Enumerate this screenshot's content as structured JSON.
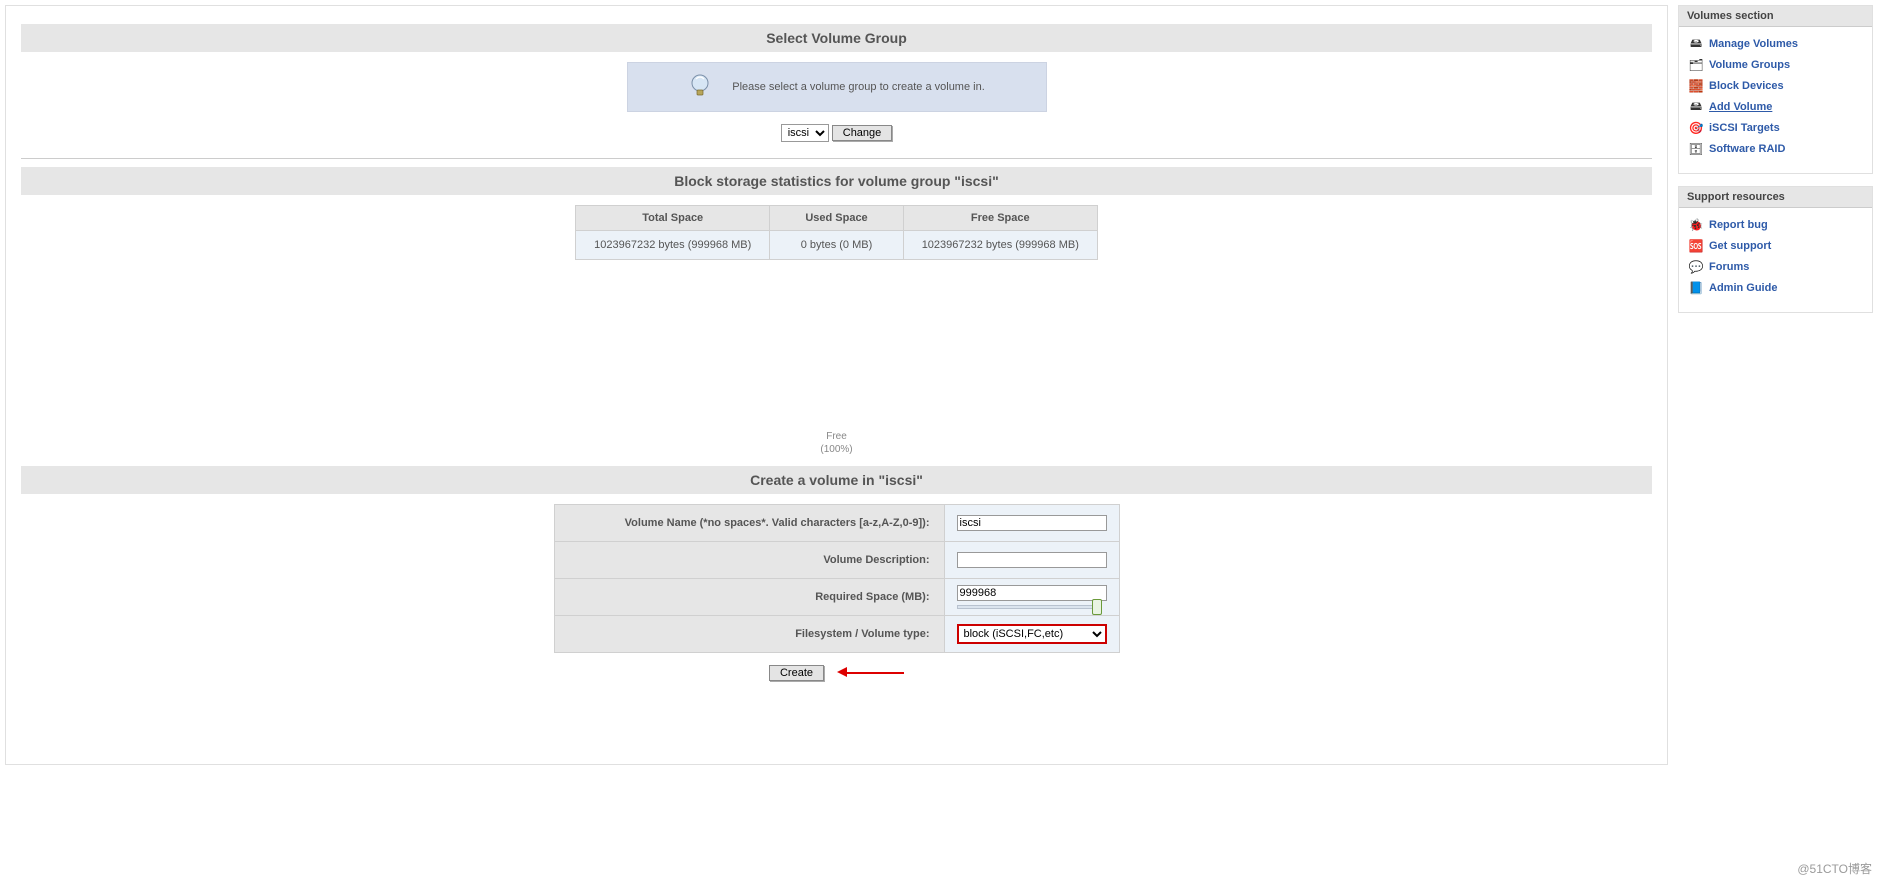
{
  "sections": {
    "select_vg_title": "Select Volume Group",
    "info_message": "Please select a volume group to create a volume in.",
    "vg_select_value": "iscsi",
    "change_btn": "Change",
    "stats_title": "Block storage statistics for volume group \"iscsi\"",
    "stats_headers": {
      "total": "Total Space",
      "used": "Used Space",
      "free": "Free Space"
    },
    "stats_values": {
      "total": "1023967232 bytes (999968 MB)",
      "used": "0 bytes (0 MB)",
      "free": "1023967232 bytes (999968 MB)"
    },
    "pie_label_1": "Free",
    "pie_label_2": "(100%)",
    "create_title": "Create a volume in \"iscsi\"",
    "form": {
      "name_label": "Volume Name (*no spaces*. Valid characters [a-z,A-Z,0-9]):",
      "name_value": "iscsi",
      "desc_label": "Volume Description:",
      "desc_value": "",
      "space_label": "Required Space (MB):",
      "space_value": "999968",
      "fs_label": "Filesystem / Volume type:",
      "fs_value": "block (iSCSI,FC,etc)"
    },
    "create_btn": "Create"
  },
  "sidebar": {
    "volumes_title": "Volumes section",
    "items": [
      {
        "icon": "drive-icon",
        "label": "Manage Volumes",
        "underline": false
      },
      {
        "icon": "layers-icon",
        "label": "Volume Groups",
        "underline": false
      },
      {
        "icon": "bricks-icon",
        "label": "Block Devices",
        "underline": false
      },
      {
        "icon": "drive-add-icon",
        "label": "Add Volume",
        "underline": true
      },
      {
        "icon": "target-icon",
        "label": "iSCSI Targets",
        "underline": false
      },
      {
        "icon": "raid-icon",
        "label": "Software RAID",
        "underline": false
      }
    ],
    "support_title": "Support resources",
    "support": [
      {
        "icon": "bug-icon",
        "label": "Report bug"
      },
      {
        "icon": "help-icon",
        "label": "Get support"
      },
      {
        "icon": "chat-icon",
        "label": "Forums"
      },
      {
        "icon": "book-icon",
        "label": "Admin Guide"
      }
    ]
  },
  "chart_data": {
    "type": "pie",
    "title": "Free (100%)",
    "series": [
      {
        "name": "Free",
        "value": 100
      }
    ]
  },
  "watermark": "@51CTO博客"
}
